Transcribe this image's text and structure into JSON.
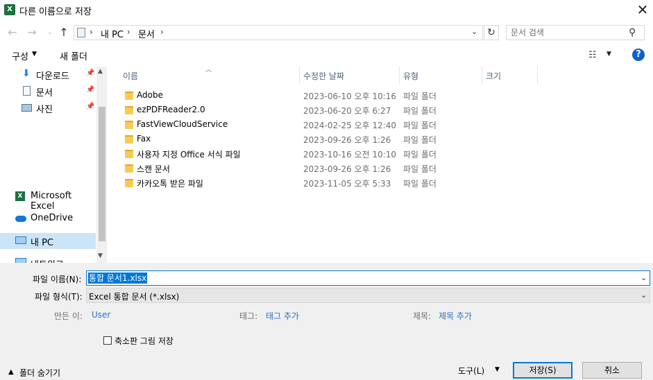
{
  "window": {
    "title": "다른 이름으로 저장",
    "app_icon_text": "X",
    "close_glyph": "✕"
  },
  "address": {
    "breadcrumbs": [
      "내 PC",
      "문서"
    ],
    "separator": "›",
    "search_placeholder": "문서 검색"
  },
  "toolbar": {
    "organize": "구성",
    "new_folder": "새 폴더",
    "help": "?"
  },
  "nav": {
    "items": [
      {
        "label": "다운로드",
        "icon": "download-icon",
        "pinned": true
      },
      {
        "label": "문서",
        "icon": "document-icon",
        "pinned": true
      },
      {
        "label": "사진",
        "icon": "picture-icon",
        "pinned": true
      },
      {
        "label": "Microsoft Excel",
        "icon": "excel-icon"
      },
      {
        "label": "OneDrive",
        "icon": "onedrive-icon"
      },
      {
        "label": "내 PC",
        "icon": "pc-icon",
        "selected": true
      },
      {
        "label": "네트워크",
        "icon": "network-icon"
      }
    ]
  },
  "columns": {
    "name": "이름",
    "date": "수정한 날짜",
    "type": "유형",
    "size": "크기"
  },
  "files": [
    {
      "name": "Adobe",
      "date": "2023-06-10 오후 10:16",
      "type": "파일 폴더"
    },
    {
      "name": "ezPDFReader2.0",
      "date": "2023-06-20 오후 6:27",
      "type": "파일 폴더"
    },
    {
      "name": "FastViewCloudService",
      "date": "2024-02-25 오후 12:40",
      "type": "파일 폴더"
    },
    {
      "name": "Fax",
      "date": "2023-09-26 오후 1:26",
      "type": "파일 폴더"
    },
    {
      "name": "사용자 지정 Office 서식 파일",
      "date": "2023-10-16 오전 10:10",
      "type": "파일 폴더"
    },
    {
      "name": "스캔 문서",
      "date": "2023-09-26 오후 1:26",
      "type": "파일 폴더"
    },
    {
      "name": "카카오톡 받은 파일",
      "date": "2023-11-05 오후 5:33",
      "type": "파일 폴더"
    }
  ],
  "form": {
    "filename_label": "파일 이름(N):",
    "filename_value": "통합 문서1.xlsx",
    "filetype_label": "파일 형식(T):",
    "filetype_value": "Excel 통합 문서 (*.xlsx)",
    "author_label": "만든 이:",
    "author_value": "User",
    "tags_label": "태그:",
    "tags_value": "태그 추가",
    "title_label": "제목:",
    "title_value": "제목 추가",
    "thumbnail_label": "축소판 그림 저장",
    "thumbnail_checked": false
  },
  "footer": {
    "hide_folders": "폴더 숨기기",
    "tools": "도구(L)",
    "save": "저장(S)",
    "cancel": "취소"
  }
}
